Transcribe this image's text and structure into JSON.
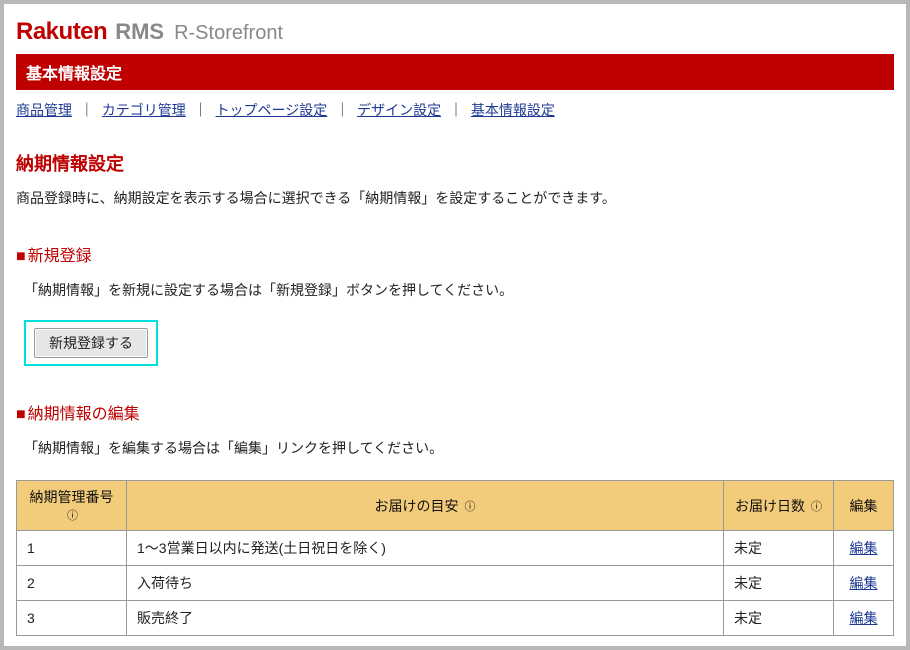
{
  "brand": {
    "main": "Rakuten",
    "sub": "RMS",
    "detail": "R-Storefront"
  },
  "title_bar": "基本情報設定",
  "breadcrumb": {
    "items": [
      {
        "label": "商品管理"
      },
      {
        "label": "カテゴリ管理"
      },
      {
        "label": "トップページ設定"
      },
      {
        "label": "デザイン設定"
      },
      {
        "label": "基本情報設定"
      }
    ],
    "sep": "｜"
  },
  "section_main_title": "納期情報設定",
  "description": "商品登録時に、納期設定を表示する場合に選択できる「納期情報」を設定することができます。",
  "register_section": {
    "heading": "新規登録",
    "text": "「納期情報」を新規に設定する場合は「新規登録」ボタンを押してください。",
    "button_label": "新規登録する"
  },
  "edit_section": {
    "heading": "納期情報の編集",
    "text": "「納期情報」を編集する場合は「編集」リンクを押してください。"
  },
  "table": {
    "headers": {
      "num": "納期管理番号",
      "guide": "お届けの目安",
      "days": "お届け日数",
      "edit": "編集"
    },
    "help_icon": "?",
    "rows": [
      {
        "num": "1",
        "guide": "1〜3営業日以内に発送(土日祝日を除く)",
        "days": "未定",
        "edit": "編集"
      },
      {
        "num": "2",
        "guide": "入荷待ち",
        "days": "未定",
        "edit": "編集"
      },
      {
        "num": "3",
        "guide": "販売終了",
        "days": "未定",
        "edit": "編集"
      }
    ]
  }
}
